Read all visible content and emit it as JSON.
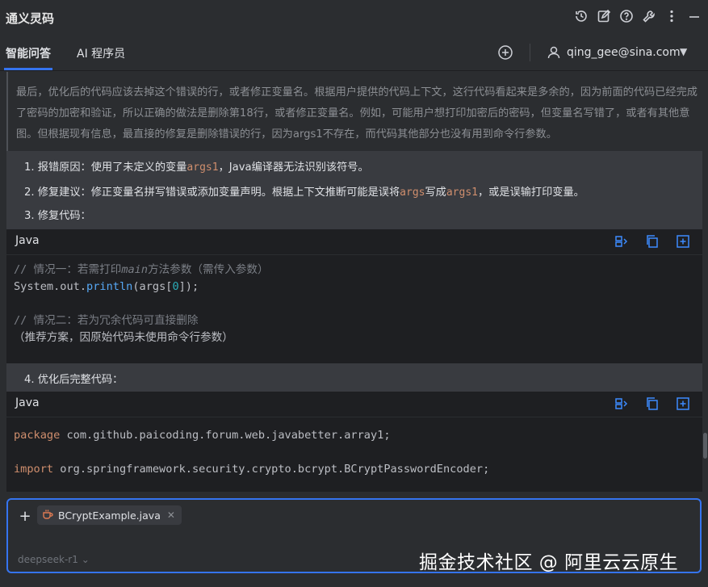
{
  "window": {
    "title": "通义灵码",
    "icons": [
      "history-icon",
      "edit-icon",
      "help-icon",
      "settings-wrench-icon",
      "more-icon",
      "minimize-icon"
    ]
  },
  "tabs": [
    {
      "label": "智能问答",
      "active": true
    },
    {
      "label": "AI 程序员",
      "active": false
    }
  ],
  "account": {
    "email": "qing_gee@sina.com"
  },
  "thinking": {
    "text": "最后，优化后的代码应该去掉这个错误的行，或者修正变量名。根据用户提供的代码上下文，这行代码看起来是多余的，因为前面的代码已经完成了密码的加密和验证，所以正确的做法是删除第18行，或者修正变量名。例如，可能用户想打印加密后的密码，但变量名写错了，或者有其他意图。但根据现有信息，最直接的修复是删除错误的行，因为args1不存在，而代码其他部分也没有用到命令行参数。"
  },
  "answer": {
    "item1": {
      "num": "1.",
      "label": "报错原因：使用了未定义的变量",
      "code": "args1",
      "rest": "，Java编译器无法识别该符号。"
    },
    "item2": {
      "num": "2.",
      "label": "修复建议：修正变量名拼写错误或添加变量声明。根据上下文推断可能是误将",
      "code1": "args",
      "mid": "写成",
      "code2": "args1",
      "rest": "，或是误输打印变量。"
    },
    "item3": {
      "num": "3.",
      "label": "修复代码："
    },
    "item4": {
      "num": "4.",
      "label": "优化后完整代码："
    }
  },
  "code_blocks": [
    {
      "lang": "Java",
      "line1_prefix": "// 情况一：若需打印",
      "line1_italic": "main",
      "line1_suffix": "方法参数（需传入参数）",
      "line2_obj": "System.out.",
      "line2_method": "println",
      "line2_args_open": "(args[",
      "line2_num": "0",
      "line2_args_close": "]);",
      "line4": "// 情况二：若为冗余代码可直接删除",
      "line5": "（推荐方案，因原始代码未使用命令行参数）"
    },
    {
      "lang": "Java",
      "kw1": "package",
      "pkg": " com.github.paicoding.forum.web.javabetter.array1;",
      "kw2": "import",
      "imp": " org.springframework.security.crypto.bcrypt.BCryptPasswordEncoder;"
    }
  ],
  "code_block_icons": [
    "insert-icon",
    "copy-icon",
    "new-file-icon"
  ],
  "input": {
    "attachment": "BCryptExample.java",
    "model": "deepseek-r1",
    "model_caret": "⌄"
  },
  "watermark": "掘金技术社区 @ 阿里云云原生",
  "colors": {
    "accent": "#3574f0",
    "code_keyword": "#cf8e6d",
    "code_method": "#56a8f5"
  }
}
